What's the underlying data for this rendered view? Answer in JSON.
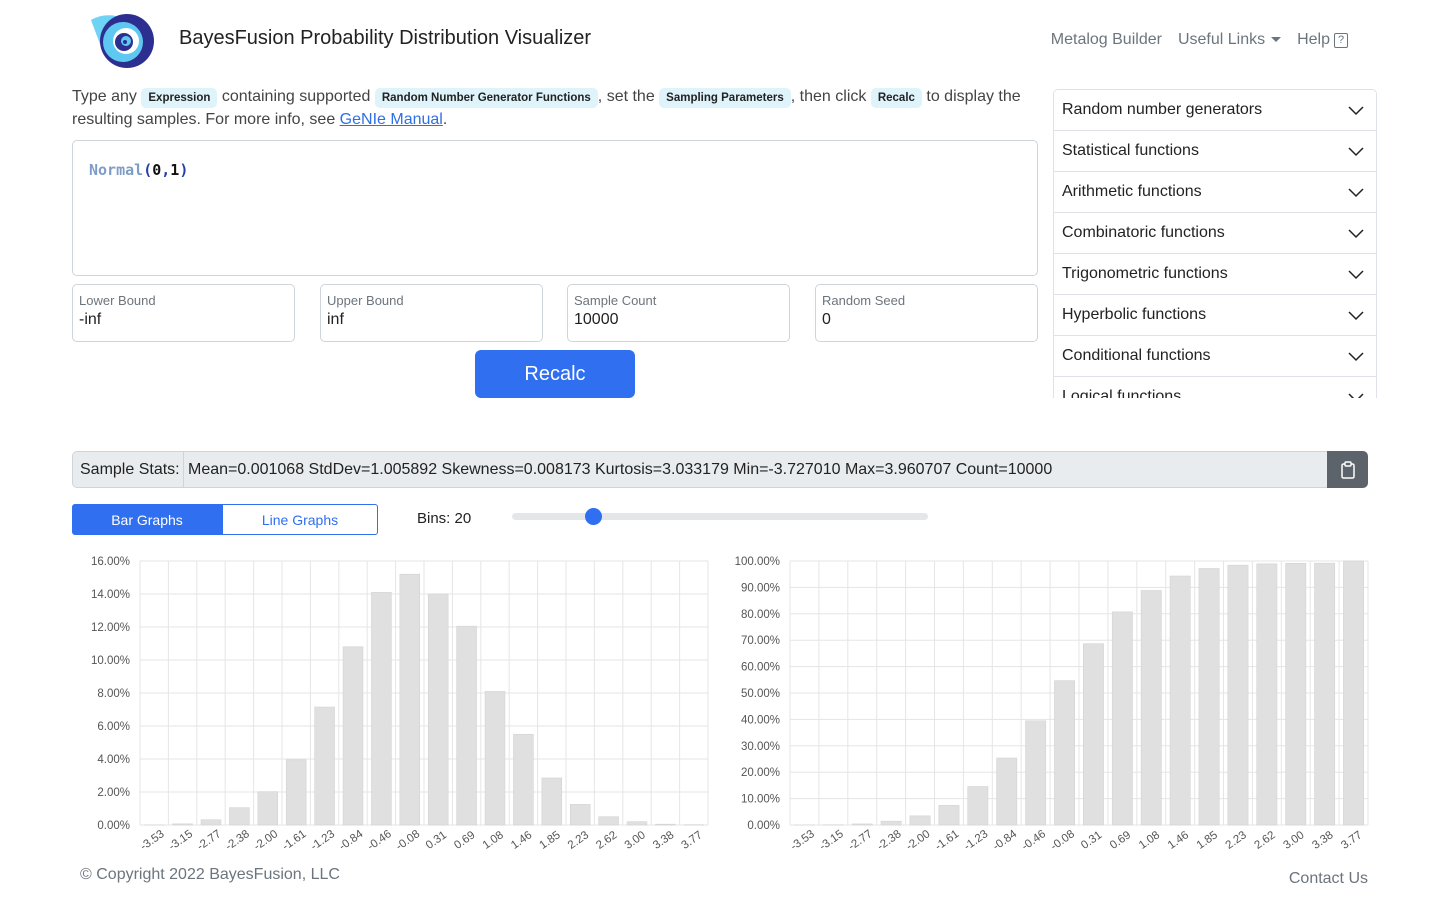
{
  "header": {
    "title": "BayesFusion Probability Distribution Visualizer",
    "nav": {
      "metalog": "Metalog Builder",
      "links": "Useful Links",
      "help": "Help",
      "help_icon": "?"
    }
  },
  "intro": {
    "t1": "Type any",
    "p1": "Expression",
    "t2": "containing supported",
    "p2": "Random Number Generator Functions",
    "t3": ", set the",
    "p3": "Sampling Parameters",
    "t4": ", then click",
    "p4": "Recalc",
    "t5": "to display the resulting samples. For more info, see",
    "link": "GeNIe Manual",
    "t6": "."
  },
  "editor": {
    "fn": "Normal",
    "open": "(",
    "a": "0",
    "comma": ",",
    "b": "1",
    "close": ")"
  },
  "params": {
    "lower": {
      "label": "Lower Bound",
      "value": "-inf"
    },
    "upper": {
      "label": "Upper Bound",
      "value": "inf"
    },
    "count": {
      "label": "Sample Count",
      "value": "10000"
    },
    "seed": {
      "label": "Random Seed",
      "value": "0"
    }
  },
  "recalc_label": "Recalc",
  "accordion": [
    "Random number generators",
    "Statistical functions",
    "Arithmetic functions",
    "Combinatoric functions",
    "Trigonometric functions",
    "Hyperbolic functions",
    "Conditional functions",
    "Logical functions"
  ],
  "stats": {
    "label": "Sample Stats:",
    "value": "Mean=0.001068 StdDev=1.005892 Skewness=0.008173 Kurtosis=3.033179 Min=-3.727010 Max=3.960707 Count=10000"
  },
  "toggle": {
    "bar": "Bar Graphs",
    "line": "Line Graphs"
  },
  "bins": {
    "label": "Bins: 20",
    "value": 20,
    "fraction": 0.19
  },
  "chart_data": [
    {
      "type": "bar",
      "ylim": [
        0,
        16
      ],
      "yticks": [
        "0.00%",
        "2.00%",
        "4.00%",
        "6.00%",
        "8.00%",
        "10.00%",
        "12.00%",
        "14.00%",
        "16.00%"
      ],
      "categories": [
        "-3.53",
        "-3.15",
        "-2.77",
        "-2.38",
        "-2.00",
        "-1.61",
        "-1.23",
        "-0.84",
        "-0.46",
        "-0.08",
        "0.31",
        "0.69",
        "1.08",
        "1.46",
        "1.85",
        "2.23",
        "2.62",
        "3.00",
        "3.38",
        "3.77"
      ],
      "values": [
        0.01,
        0.07,
        0.32,
        1.05,
        2.02,
        3.95,
        7.15,
        10.8,
        14.1,
        15.2,
        14.0,
        12.05,
        8.1,
        5.5,
        2.85,
        1.25,
        0.5,
        0.2,
        0.05,
        0.02
      ]
    },
    {
      "type": "bar",
      "ylim": [
        0,
        100
      ],
      "yticks": [
        "0.00%",
        "10.00%",
        "20.00%",
        "30.00%",
        "40.00%",
        "50.00%",
        "60.00%",
        "70.00%",
        "80.00%",
        "90.00%",
        "100.00%"
      ],
      "categories": [
        "-3.53",
        "-3.15",
        "-2.77",
        "-2.38",
        "-2.00",
        "-1.61",
        "-1.23",
        "-0.84",
        "-0.46",
        "-0.08",
        "0.31",
        "0.69",
        "1.08",
        "1.46",
        "1.85",
        "2.23",
        "2.62",
        "3.00",
        "3.38",
        "3.77"
      ],
      "values": [
        0.01,
        0.08,
        0.4,
        1.45,
        3.47,
        7.42,
        14.57,
        25.37,
        39.47,
        54.67,
        68.67,
        80.72,
        88.82,
        94.32,
        97.17,
        98.42,
        98.92,
        99.12,
        99.17,
        100
      ]
    }
  ],
  "footer": {
    "copyright": "© Copyright 2022 BayesFusion, LLC",
    "contact": "Contact Us"
  }
}
